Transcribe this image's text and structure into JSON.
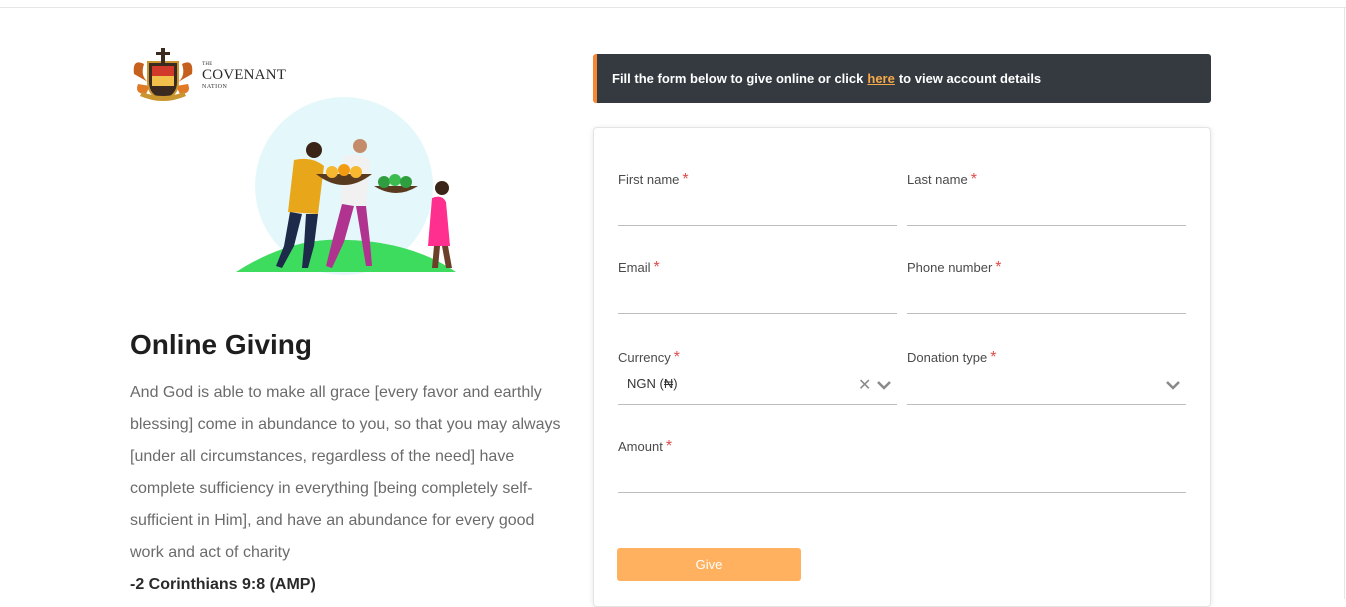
{
  "logo": {
    "the": "THE",
    "name": "COVENANT",
    "nation": "NATION"
  },
  "page": {
    "title": "Online Giving",
    "verse": "And God is able to make all grace [every favor and earthly blessing] come in abundance to you, so that you may always [under all circumstances, regardless of the need] have complete sufficiency in everything [being completely self-sufficient in Him], and have an abundance for every good work and act of charity",
    "reference": "-2 Corinthians 9:8 (AMP)"
  },
  "banner": {
    "prefix": "Fill the form below to give online or click",
    "link": "here",
    "suffix": "to view account details"
  },
  "form": {
    "first_name": {
      "label": "First name",
      "required": "*",
      "value": ""
    },
    "last_name": {
      "label": "Last name",
      "required": "*",
      "value": ""
    },
    "email": {
      "label": "Email",
      "required": "*",
      "value": ""
    },
    "phone": {
      "label": "Phone number",
      "required": "*",
      "value": ""
    },
    "currency": {
      "label": "Currency",
      "required": "*",
      "selected": "NGN (₦)"
    },
    "donation_type": {
      "label": "Donation type",
      "required": "*",
      "selected": ""
    },
    "amount": {
      "label": "Amount",
      "required": "*",
      "value": ""
    },
    "submit_label": "Give"
  },
  "colors": {
    "accent": "#f58634",
    "button": "#ffb15f",
    "banner_bg": "#343a40",
    "required": "#e04b4b"
  }
}
